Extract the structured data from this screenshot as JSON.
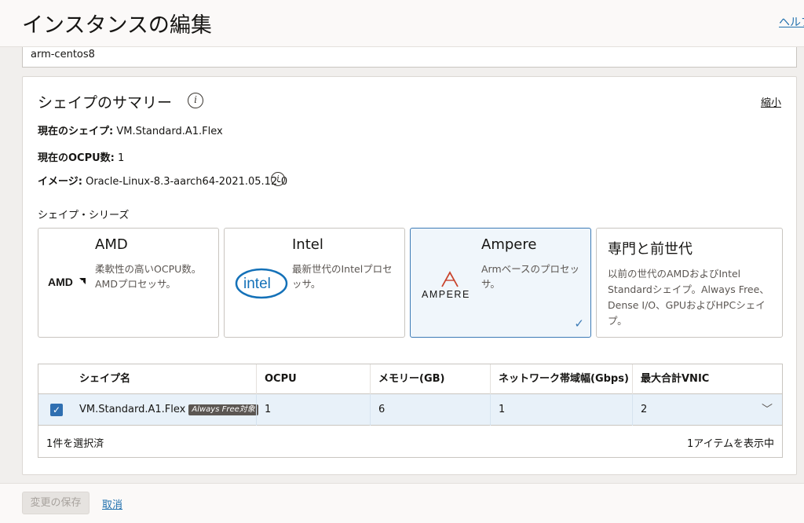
{
  "header": {
    "title": "インスタンスの編集",
    "help_link": "ヘルプ"
  },
  "instance_name": "arm-centos8",
  "summary": {
    "title": "シェイプのサマリー",
    "collapse_label": "縮小",
    "current_shape_label": "現在のシェイプ:",
    "current_shape_value": "VM.Standard.A1.Flex",
    "current_ocpu_label": "現在のOCPU数:",
    "current_ocpu_value": "1",
    "image_label": "イメージ:",
    "image_value": "Oracle-Linux-8.3-aarch64-2021.05.12-0"
  },
  "series": {
    "label": "シェイプ・シリーズ",
    "cards": [
      {
        "title": "AMD",
        "desc": "柔軟性の高いOCPU数。AMDプロセッサ。",
        "logo_text": "AMDA",
        "selected": false
      },
      {
        "title": "Intel",
        "desc": "最新世代のIntelプロセッサ。",
        "logo_text": "intel",
        "selected": false
      },
      {
        "title": "Ampere",
        "desc": "Armベースのプロセッサ。",
        "logo_text": "AMPERE",
        "selected": true
      },
      {
        "title": "専門と前世代",
        "desc": "以前の世代のAMDおよびIntel Standardシェイプ。Always Free、Dense I/O、GPUおよびHPCシェイプ。",
        "selected": false
      }
    ]
  },
  "table": {
    "columns": [
      "シェイプ名",
      "OCPU",
      "メモリー(GB)",
      "ネットワーク帯域幅(Gbps)",
      "最大合計VNIC"
    ],
    "row": {
      "checked": true,
      "shape": "VM.Standard.A1.Flex",
      "badge": "Always Free対象",
      "ocpu": "1",
      "memory": "6",
      "network": "1",
      "vnic": "2"
    },
    "footer_left": "1件を選択済",
    "footer_right": "1アイテムを表示中"
  },
  "footer": {
    "save_label": "変更の保存",
    "cancel_label": "取消"
  },
  "colors": {
    "accent": "#2f6fb1",
    "link": "#1f6fad",
    "amd_red": "#c9432b"
  }
}
